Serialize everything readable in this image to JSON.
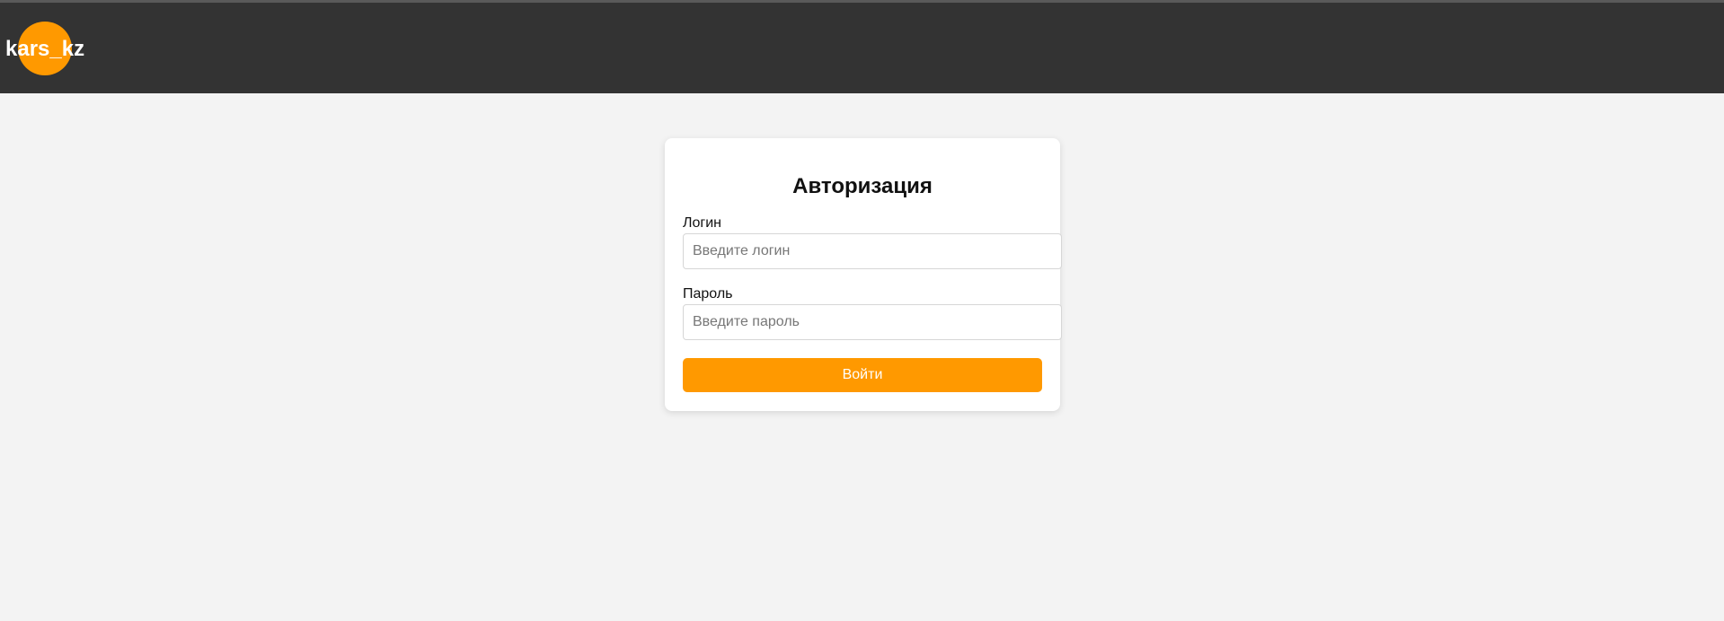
{
  "header": {
    "logo_text": "kars_kz"
  },
  "login_form": {
    "title": "Авторизация",
    "login_label": "Логин",
    "login_placeholder": "Введите логин",
    "login_value": "",
    "password_label": "Пароль",
    "password_placeholder": "Введите пароль",
    "password_value": "",
    "submit_label": "Войти"
  },
  "colors": {
    "header_bg": "#333333",
    "accent": "#ff9900",
    "page_bg": "#f3f3f3",
    "card_bg": "#ffffff"
  }
}
